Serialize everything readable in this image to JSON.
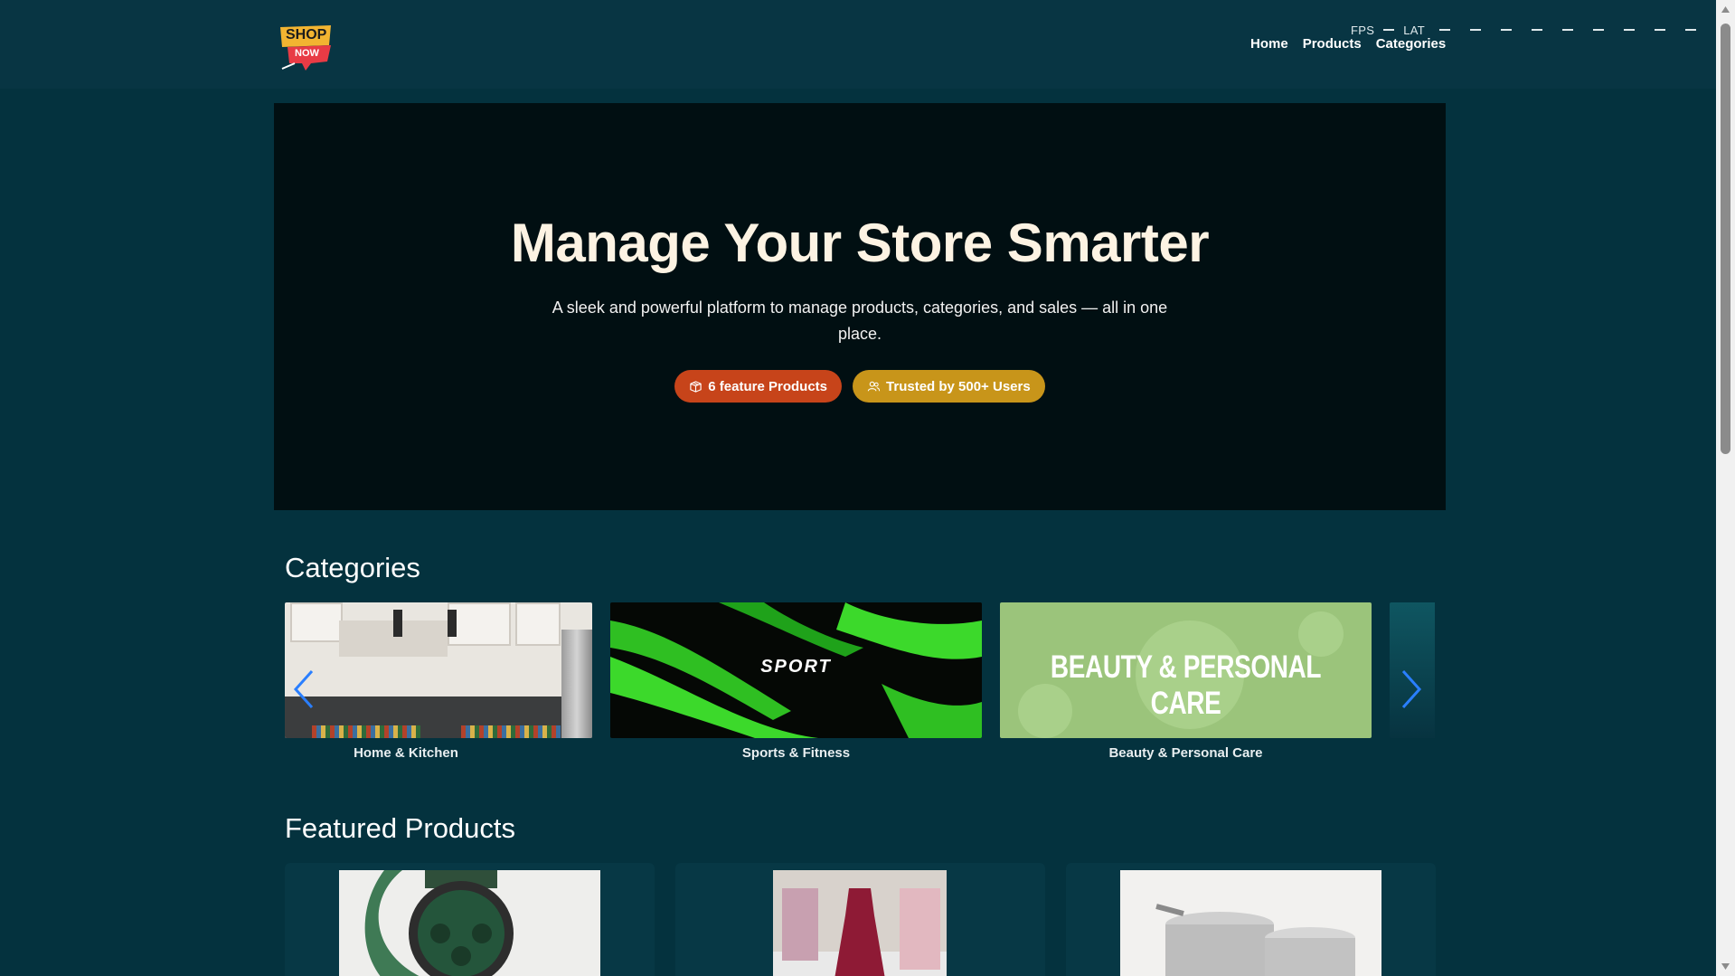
{
  "header": {
    "logo": {
      "top_text": "SHOP",
      "bottom_text": "NOW"
    },
    "perf": {
      "fps_label": "FPS",
      "lat_label": "LAT"
    },
    "nav": [
      {
        "label": "Home"
      },
      {
        "label": "Products"
      },
      {
        "label": "Categories"
      }
    ]
  },
  "hero": {
    "title": "Manage Your Store Smarter",
    "subtitle": "A sleek and powerful platform to manage products, categories, and sales — all in one place.",
    "badges": [
      {
        "label": "6 feature Products",
        "icon": "box-icon",
        "color": "#c7441a"
      },
      {
        "label": "Trusted by 500+ Users",
        "icon": "users-icon",
        "color": "#c8951a"
      }
    ]
  },
  "categories": {
    "title": "Categories",
    "items": [
      {
        "label": "Home & Kitchen"
      },
      {
        "label": "Sports & Fitness",
        "image_text": "SPORT"
      },
      {
        "label": "Beauty & Personal Care",
        "image_text": "BEAUTY & PERSONAL CARE"
      },
      {
        "label": ""
      }
    ]
  },
  "featured": {
    "title": "Featured Products",
    "items": [
      {
        "image": "smartwatch"
      },
      {
        "image": "dress"
      },
      {
        "image": "cookware"
      }
    ]
  },
  "colors": {
    "page_bg": "#04323e",
    "header_bg": "#083543",
    "hero_bg": "#010f12",
    "accent_orange": "#c7441a",
    "accent_gold": "#c8951a",
    "carousel_arrow": "#2a7fff"
  }
}
